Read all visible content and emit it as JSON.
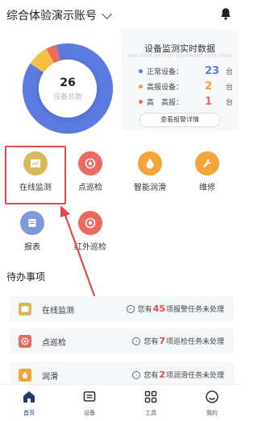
{
  "header": {
    "account_name": "综合体验演示账号"
  },
  "donut": {
    "total": "26",
    "total_label": "设备总数",
    "segments": [
      {
        "name": "正常设备",
        "value": 23,
        "color": "#5b7be0"
      },
      {
        "name": "高报设备",
        "value": 2,
        "color": "#f6c142"
      },
      {
        "name": "高高报",
        "value": 1,
        "color": "#ef6a5a"
      }
    ]
  },
  "stats": {
    "title": "设备监测实时数据",
    "subtitle": "REAL-TIME DATA OF EQUIPMENT DETECTION",
    "rows": [
      {
        "label": "正常设备：",
        "value": "23",
        "unit": "台",
        "color": "#5b7be0"
      },
      {
        "label": "高报设备：",
        "value": "2",
        "unit": "台",
        "color": "#f0a030"
      },
      {
        "label": "高　高报：",
        "value": "1",
        "unit": "台",
        "color": "#ef6a5a"
      }
    ],
    "alarm_button": "查看报警详情"
  },
  "grid": [
    {
      "label": "在线监测",
      "color": "#d9b85a",
      "icon": "monitor-icon"
    },
    {
      "label": "点巡检",
      "color": "#ec6a60",
      "icon": "target-icon"
    },
    {
      "label": "智能润滑",
      "color": "#f4a53a",
      "icon": "drop-icon"
    },
    {
      "label": "维修",
      "color": "#f4a53a",
      "icon": "wrench-icon"
    },
    {
      "label": "报表",
      "color": "#7f98d8",
      "icon": "report-icon"
    },
    {
      "label": "红外巡检",
      "color": "#ec6a60",
      "icon": "target-icon"
    }
  ],
  "todo": {
    "title": "待办事项",
    "items": [
      {
        "name": "在线监测",
        "prefix": "您有",
        "count": "45",
        "suffix": "项报警任务未处理",
        "color": "#d9b85a"
      },
      {
        "name": "点巡检",
        "prefix": "您有",
        "count": "7",
        "suffix": "项巡检任务未处理",
        "color": "#ec6a60"
      },
      {
        "name": "润滑",
        "prefix": "您有",
        "count": "2",
        "suffix": "项润滑任务未处理",
        "color": "#f4a53a"
      }
    ]
  },
  "nav": [
    {
      "label": "首页",
      "icon": "home-icon",
      "active": true
    },
    {
      "label": "设备",
      "icon": "device-icon",
      "active": false
    },
    {
      "label": "工具",
      "icon": "tools-icon",
      "active": false
    },
    {
      "label": "我的",
      "icon": "profile-icon",
      "active": false
    }
  ]
}
